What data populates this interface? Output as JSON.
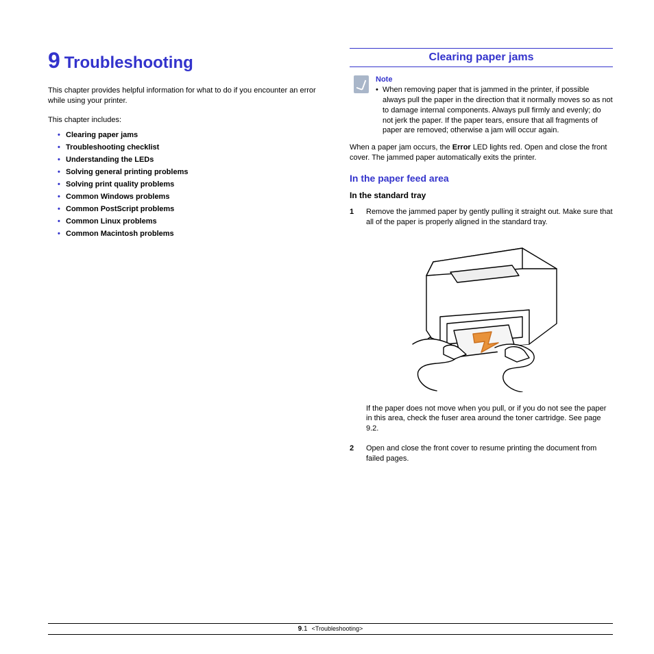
{
  "chapter": {
    "number": "9",
    "title": "Troubleshooting"
  },
  "intro": "This chapter provides helpful information for what to do if you encounter an error while using your printer.",
  "includes_label": "This chapter includes:",
  "toc": [
    "Clearing paper jams",
    "Troubleshooting checklist",
    "Understanding the LEDs",
    "Solving general printing problems",
    "Solving print quality problems",
    "Common Windows problems",
    "Common PostScript problems",
    "Common Linux problems",
    "Common Macintosh problems"
  ],
  "section": {
    "title": "Clearing paper jams"
  },
  "note": {
    "label": "Note",
    "text": "When removing paper that is jammed in the printer, if possible always pull the paper in the direction that it normally moves so as not to damage internal components. Always pull firmly and evenly; do not jerk the paper. If the paper tears, ensure that all fragments of paper are removed; otherwise a jam will occur again."
  },
  "jam_para_pre": "When a paper jam occurs, the ",
  "jam_para_bold": "Error",
  "jam_para_post": " LED lights red. Open and close the front cover. The jammed paper automatically exits the printer.",
  "subsection": {
    "title": "In the paper feed area",
    "tray": "In the standard tray"
  },
  "steps": {
    "s1": {
      "n": "1",
      "text": "Remove the jammed paper by gently pulling it straight out. Make sure that all of the paper is properly aligned in the standard tray."
    },
    "after1": "If the paper does not move when you pull, or if you do not see the paper in this area, check the fuser area around the toner cartridge. See page 9.2.",
    "s2": {
      "n": "2",
      "text": "Open and close the front cover to resume printing the document from failed pages."
    }
  },
  "footer": {
    "page": "9",
    "sub": ".1",
    "label": "<Troubleshooting>"
  }
}
